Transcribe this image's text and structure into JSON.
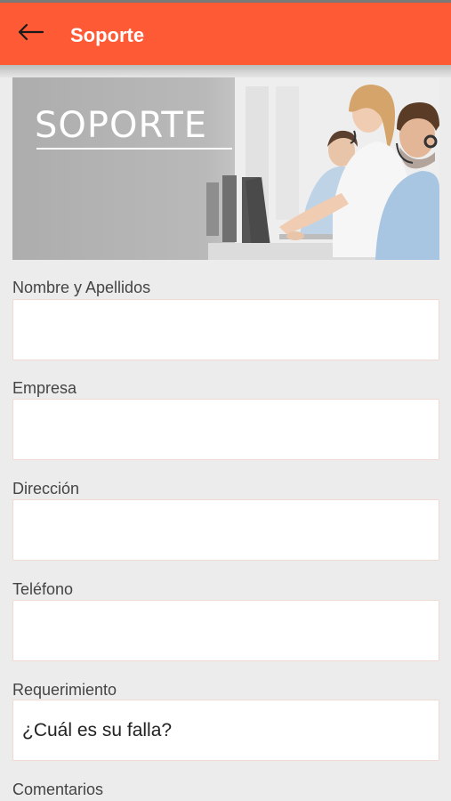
{
  "app_bar": {
    "title": "Soporte",
    "back_icon": "arrow-left-icon",
    "color": "#ff5a36"
  },
  "banner": {
    "title": "SOPORTE",
    "image": "call-center-agents-photo"
  },
  "form": {
    "fields": [
      {
        "label": "Nombre y Apellidos",
        "value": "",
        "placeholder": ""
      },
      {
        "label": "Empresa",
        "value": "",
        "placeholder": ""
      },
      {
        "label": "Dirección",
        "value": "",
        "placeholder": ""
      },
      {
        "label": "Teléfono",
        "value": "",
        "placeholder": ""
      },
      {
        "label": "Requerimiento",
        "value": "",
        "placeholder": "¿Cuál es su falla?"
      },
      {
        "label": "Comentarios"
      }
    ]
  }
}
